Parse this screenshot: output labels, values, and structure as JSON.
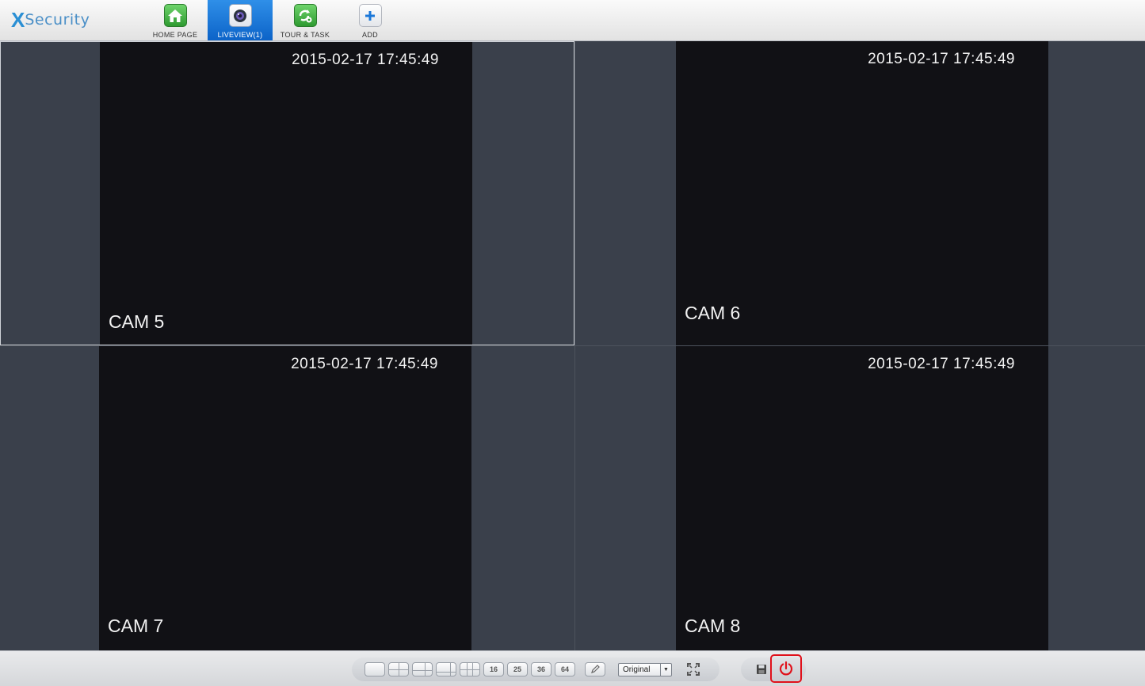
{
  "app": {
    "logo_x": "X",
    "logo_text": "Security"
  },
  "nav": {
    "items": [
      {
        "label": "HOME PAGE",
        "icon": "home-icon"
      },
      {
        "label": "LIVEVIEW(1)",
        "icon": "camera-icon",
        "active": true
      },
      {
        "label": "TOUR & TASK",
        "icon": "refresh-gear-icon"
      },
      {
        "label": "ADD",
        "icon": "plus-icon"
      }
    ]
  },
  "panes": [
    {
      "timestamp": "2015-02-17 17:45:49",
      "camera": "CAM 5",
      "selected": true
    },
    {
      "timestamp": "2015-02-17 17:45:49",
      "camera": "CAM 6"
    },
    {
      "timestamp": "2015-02-17 17:45:49",
      "camera": "CAM 7"
    },
    {
      "timestamp": "2015-02-17 17:45:49",
      "camera": "CAM 8"
    }
  ],
  "toolbar": {
    "layouts": [
      "1",
      "4",
      "6",
      "8",
      "9",
      "16",
      "25",
      "36",
      "64"
    ],
    "layout_16": "16",
    "layout_25": "25",
    "layout_36": "36",
    "layout_64": "64",
    "ratio_value": "Original",
    "ratio_arrow": "▼"
  },
  "colors": {
    "accent": "#1a77d8",
    "power": "#e0111b",
    "video_bg": "#111115",
    "pane_bg": "#3a404b"
  }
}
